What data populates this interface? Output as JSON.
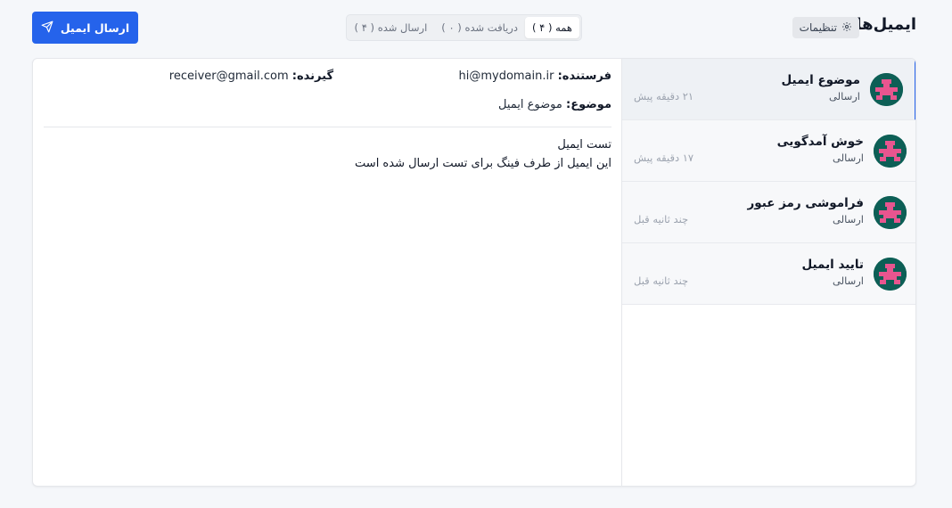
{
  "header": {
    "title": "ایمیل‌ها",
    "settings_label": "تنظیمات",
    "filters": [
      {
        "label": "همه ( ۴ )",
        "active": true
      },
      {
        "label": "دریافت شده ( ۰ )",
        "active": false
      },
      {
        "label": "ارسال شده ( ۴ )",
        "active": false
      }
    ],
    "send_button_label": "ارسال ایمیل"
  },
  "detail": {
    "from_label": "فرستنده:",
    "from_value": "hi@mydomain.ir",
    "to_label": "گیرنده:",
    "to_value": "receiver@gmail.com",
    "subject_label": "موضوع:",
    "subject_value": "موضوع ایمیل",
    "body_lines": [
      "تست ایمیل",
      "این ایمیل از طرف فینگ برای تست ارسال شده است"
    ]
  },
  "emails": [
    {
      "title": "موضوع ایمیل",
      "status": "ارسالی",
      "time": "۲۱ دقیقه پیش",
      "selected": true
    },
    {
      "title": "خوش آمدگویی",
      "status": "ارسالی",
      "time": "۱۷ دقیقه پیش",
      "selected": false
    },
    {
      "title": "فراموشی رمز عبور",
      "status": "ارسالی",
      "time": "چند ثانیه قبل",
      "selected": false
    },
    {
      "title": "تایید ایمیل",
      "status": "ارسالی",
      "time": "چند ثانیه قبل",
      "selected": false
    }
  ],
  "colors": {
    "accent": "#2563eb",
    "avatar_bg": "#0d5f56",
    "avatar_fg": "#e8558f"
  },
  "icons": {
    "settings": "gear-icon",
    "send": "paper-plane-icon",
    "avatar": "identicon-avatar"
  }
}
